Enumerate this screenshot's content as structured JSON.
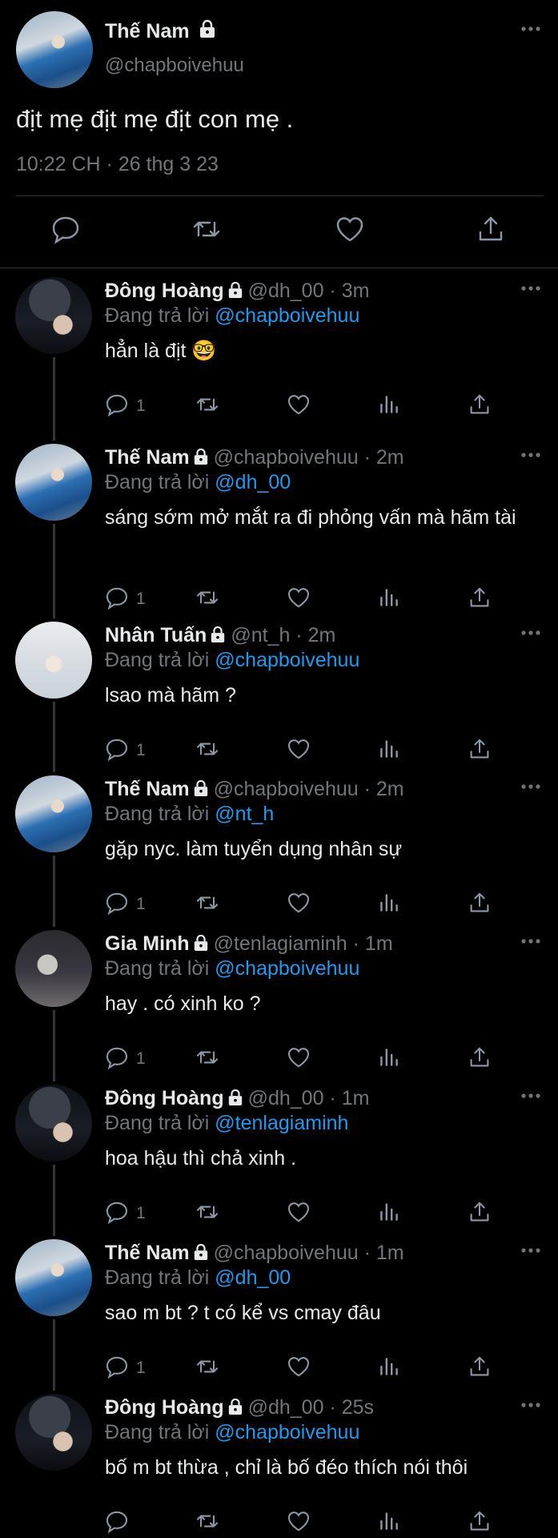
{
  "main_tweet": {
    "name": "Thế Nam",
    "handle": "@chapboivehuu",
    "text": "địt mẹ địt mẹ địt con mẹ .",
    "time": "10:22 CH · 26 thg 3 23"
  },
  "replies": [
    {
      "name": "Đông Hoàng",
      "handle": "@dh_00 · 3m",
      "reply_prefix": "Đang trả lời",
      "reply_to": "@chapboivehuu",
      "text": "hẳn là địt 🤓",
      "reply_count": "1"
    },
    {
      "name": "Thế Nam",
      "handle": "@chapboivehuu · 2m",
      "reply_prefix": "Đang trả lời",
      "reply_to": "@dh_00",
      "text": "sáng sớm mở mắt ra đi phỏng vấn mà hãm tài",
      "reply_count": "1"
    },
    {
      "name": "Nhân Tuấn",
      "handle": "@nt_h · 2m",
      "reply_prefix": "Đang trả lời",
      "reply_to": "@chapboivehuu",
      "text": "lsao mà hãm ?",
      "reply_count": "1"
    },
    {
      "name": "Thế Nam",
      "handle": "@chapboivehuu · 2m",
      "reply_prefix": "Đang trả lời",
      "reply_to": "@nt_h",
      "text": "gặp nyc. làm tuyển dụng nhân sự",
      "reply_count": "1"
    },
    {
      "name": "Gia Minh",
      "handle": "@tenlagiaminh · 1m",
      "reply_prefix": "Đang trả lời",
      "reply_to": "@chapboivehuu",
      "text": "hay . có xinh ko ?",
      "reply_count": "1"
    },
    {
      "name": "Đông Hoàng",
      "handle": "@dh_00 · 1m",
      "reply_prefix": "Đang trả lời",
      "reply_to": "@tenlagiaminh",
      "text": "hoa hậu thì chả xinh .",
      "reply_count": "1"
    },
    {
      "name": "Thế Nam",
      "handle": "@chapboivehuu · 1m",
      "reply_prefix": "Đang trả lời",
      "reply_to": "@dh_00",
      "text": "sao m bt ? t có kể vs cmay đâu",
      "reply_count": "1"
    },
    {
      "name": "Đông Hoàng",
      "handle": "@dh_00 · 25s",
      "reply_prefix": "Đang trả lời",
      "reply_to": "@chapboivehuu",
      "text": "bố m bt thừa , chỉ là bố đéo thích nói thôi",
      "reply_count": ""
    }
  ],
  "icons": {
    "reply": "speech-bubble-icon",
    "retweet": "retweet-icon",
    "like": "heart-icon",
    "views": "bar-chart-icon",
    "share": "share-icon",
    "more": "more-dots-icon",
    "lock": "lock-icon"
  },
  "colors": {
    "background": "#000000",
    "text": "#e7e9ea",
    "secondary": "#71767b",
    "link": "#1d9bf0",
    "divider": "#2f3336"
  }
}
